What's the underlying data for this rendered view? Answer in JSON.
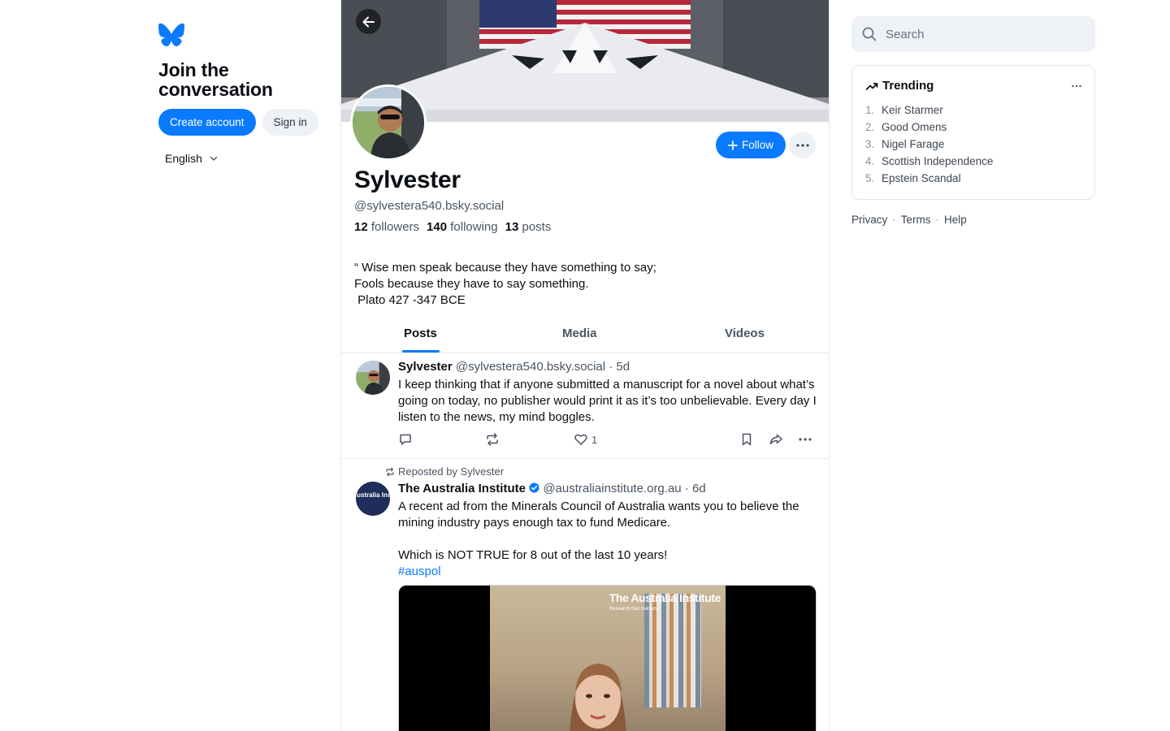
{
  "left": {
    "logo_icon": "butterfly-icon",
    "join_title": "Join the conversation",
    "create_account": "Create account",
    "sign_in": "Sign in",
    "language": "English"
  },
  "profile": {
    "name": "Sylvester",
    "handle": "@sylvestera540.bsky.social",
    "followers_count": "12",
    "followers_label": "followers",
    "following_count": "140",
    "following_label": "following",
    "posts_count": "13",
    "posts_label": "posts",
    "bio": "“ Wise men speak because they have something to say;\nFools because they have to say something.\n Plato 427 -347 BCE",
    "follow_label": "Follow"
  },
  "tabs": [
    {
      "label": "Posts",
      "active": true
    },
    {
      "label": "Media",
      "active": false
    },
    {
      "label": "Videos",
      "active": false
    }
  ],
  "posts": [
    {
      "author": "Sylvester",
      "handle": "@sylvestera540.bsky.social",
      "time": "· 5d",
      "text": "I keep thinking that if anyone submitted a manuscript for a novel about what’s going on today, no publisher would print it as it’s too unbelievable. Every day I listen to the news, my mind boggles.",
      "likes": "1"
    },
    {
      "repost_label": "Reposted by Sylvester",
      "author": "The Australia Institute",
      "verified": true,
      "handle": "@australiainstitute.org.au",
      "time": "· 6d",
      "text": "A recent ad from the Minerals Council of Australia wants you to believe the mining industry pays enough tax to fund Medicare.\n\nWhich is NOT TRUE for 8 out of the last 10 years!",
      "hashtag": "#auspol",
      "media_watermark": "The Australia Institute",
      "media_watermark_sub": "Research that matters.",
      "avatar_text": "The Australia Institute"
    }
  ],
  "right": {
    "search_placeholder": "Search",
    "trending_title": "Trending",
    "trending": [
      {
        "num": "1.",
        "label": "Keir Starmer"
      },
      {
        "num": "2.",
        "label": "Good Omens"
      },
      {
        "num": "3.",
        "label": "Nigel Farage"
      },
      {
        "num": "4.",
        "label": "Scottish Independence"
      },
      {
        "num": "5.",
        "label": "Epstein Scandal"
      }
    ],
    "footer": [
      "Privacy",
      "Terms",
      "Help"
    ]
  },
  "colors": {
    "accent": "#0a7aff",
    "text": "#0b0f14",
    "muted": "#4b5563",
    "border": "#e6e9ee"
  }
}
